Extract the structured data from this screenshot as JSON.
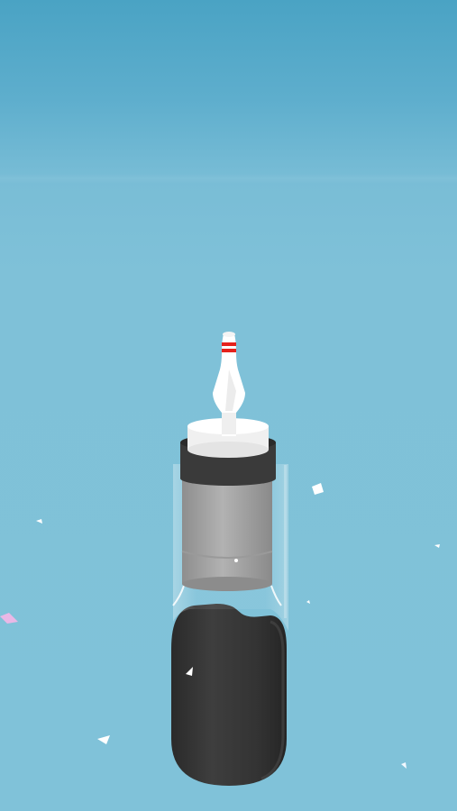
{
  "scene": {
    "background_top": "#4aa3c4",
    "background_bottom": "#80c2d9",
    "bottle_color": "#3c3c3c",
    "cap_color": "#a9a9a9",
    "pin_stripe_color": "#e5221c",
    "pin_color": "#ffffff"
  }
}
